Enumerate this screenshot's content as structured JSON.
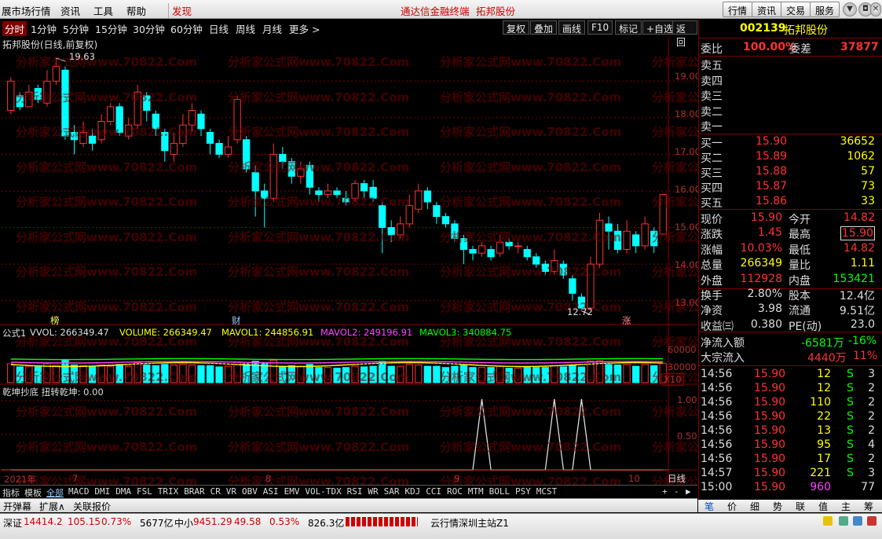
{
  "menu": {
    "left_items": [
      "展市场行情",
      "资讯",
      "工具",
      "帮助"
    ],
    "discover": "发现",
    "title": "通达信金融终端",
    "stock_name": "拓邦股份",
    "right_buttons": [
      "行情",
      "资讯",
      "交易",
      "服务"
    ]
  },
  "periods": [
    "分时",
    "1分钟",
    "5分钟",
    "15分钟",
    "30分钟",
    "60分钟",
    "日线",
    "周线",
    "月线",
    "更多 >"
  ],
  "tools": [
    "复权",
    "叠加",
    "画线",
    "F10",
    "标记",
    "+自选",
    "返回"
  ],
  "chart": {
    "title": "拓邦股份(日线,前复权)",
    "high_label": "19.63",
    "low_label": "12.72",
    "badge1": "榜",
    "badge2": "财",
    "badge3": "涨",
    "price_ticks": [
      "19.00",
      "18.00",
      "17.00",
      "16.00",
      "15.00",
      "14.00",
      "13.00"
    ],
    "watermark": "分析家公式网www.70822.Com",
    "vol_formula": "公式1",
    "vol_vvol": "VVOL: 266349.47",
    "vol_volume": "VOLUME: 266349.47",
    "vol_mavol1": "MAVOL1: 244856.91",
    "vol_mavol2": "MAVOL2: 249196.91",
    "vol_mavol3": "MAVOL3: 340884.75",
    "vol_ticks": [
      "60000",
      "30000",
      "X10"
    ],
    "ind_title": "乾坤抄底  扭转乾坤: 0.00",
    "ind_ticks": [
      "1.00",
      "0.50"
    ],
    "x_year": "2021年",
    "x_months": [
      "7",
      "8",
      "9",
      "10"
    ],
    "period_label": "日线"
  },
  "chart_data": {
    "type": "candlestick",
    "title": "拓邦股份(日线,前复权)",
    "ylim": [
      12.5,
      19.8
    ],
    "max_price": 19.63,
    "min_price": 12.72,
    "candles": [
      [
        18.2,
        19.0,
        19.1,
        18.1
      ],
      [
        18.6,
        18.3,
        18.7,
        18.2
      ],
      [
        18.3,
        18.7,
        18.9,
        18.3
      ],
      [
        18.8,
        18.5,
        18.9,
        18.4
      ],
      [
        18.4,
        19.0,
        19.3,
        18.3
      ],
      [
        19.0,
        19.4,
        19.63,
        18.9
      ],
      [
        19.3,
        17.5,
        19.4,
        17.4
      ],
      [
        17.6,
        17.4,
        17.8,
        17.0
      ],
      [
        17.3,
        17.6,
        17.9,
        17.2
      ],
      [
        17.5,
        17.3,
        17.7,
        17.1
      ],
      [
        17.4,
        17.9,
        18.1,
        17.3
      ],
      [
        17.9,
        18.3,
        18.4,
        17.8
      ],
      [
        18.3,
        17.6,
        18.4,
        17.5
      ],
      [
        17.5,
        17.8,
        18.0,
        17.4
      ],
      [
        17.8,
        18.7,
        18.9,
        17.7
      ],
      [
        18.6,
        18.2,
        18.7,
        17.9
      ],
      [
        18.1,
        17.7,
        18.2,
        17.5
      ],
      [
        17.6,
        17.1,
        17.7,
        16.8
      ],
      [
        17.0,
        17.3,
        17.6,
        16.8
      ],
      [
        17.3,
        17.8,
        18.1,
        17.2
      ],
      [
        17.8,
        18.2,
        18.4,
        17.6
      ],
      [
        18.1,
        17.7,
        18.2,
        17.5
      ],
      [
        17.6,
        17.3,
        17.7,
        17.0
      ],
      [
        17.3,
        17.0,
        17.4,
        16.9
      ],
      [
        17.0,
        17.2,
        17.5,
        16.9
      ],
      [
        17.4,
        18.5,
        18.6,
        17.3
      ],
      [
        17.4,
        16.6,
        17.5,
        16.5
      ],
      [
        16.5,
        16.0,
        16.7,
        15.3
      ],
      [
        16.0,
        15.8,
        16.2,
        15.0
      ],
      [
        15.8,
        17.0,
        17.3,
        15.7
      ],
      [
        17.0,
        16.8,
        17.2,
        16.6
      ],
      [
        16.8,
        16.4,
        16.9,
        16.2
      ],
      [
        16.4,
        16.6,
        16.8,
        16.2
      ],
      [
        16.7,
        16.1,
        16.8,
        15.9
      ],
      [
        16.0,
        15.9,
        16.1,
        15.7
      ],
      [
        15.9,
        16.0,
        16.2,
        15.8
      ],
      [
        16.0,
        15.9,
        16.1,
        15.8
      ],
      [
        15.8,
        15.7,
        16.0,
        15.6
      ],
      [
        15.8,
        16.2,
        16.3,
        15.7
      ],
      [
        16.2,
        16.0,
        16.3,
        15.8
      ],
      [
        16.1,
        15.8,
        16.3,
        15.7
      ],
      [
        15.6,
        15.0,
        15.7,
        14.3
      ],
      [
        15.0,
        14.8,
        15.2,
        14.6
      ],
      [
        14.8,
        15.1,
        15.3,
        14.7
      ],
      [
        15.1,
        15.6,
        15.9,
        15.0
      ],
      [
        15.5,
        16.0,
        16.2,
        15.4
      ],
      [
        16.0,
        15.7,
        16.1,
        15.5
      ],
      [
        15.6,
        15.3,
        15.7,
        15.1
      ],
      [
        15.3,
        15.1,
        15.4,
        15.0
      ],
      [
        15.1,
        14.7,
        15.2,
        14.6
      ],
      [
        14.7,
        14.4,
        14.8,
        14.0
      ],
      [
        14.4,
        14.3,
        14.5,
        14.1
      ],
      [
        14.3,
        14.5,
        14.6,
        14.2
      ],
      [
        14.4,
        14.2,
        14.5,
        14.1
      ],
      [
        14.3,
        14.6,
        14.8,
        14.2
      ],
      [
        14.6,
        14.5,
        14.7,
        14.4
      ],
      [
        14.5,
        14.5,
        14.6,
        14.3
      ],
      [
        14.4,
        14.2,
        14.5,
        14.1
      ],
      [
        14.2,
        14.0,
        14.3,
        13.9
      ],
      [
        14.0,
        13.8,
        14.1,
        13.7
      ],
      [
        13.8,
        14.1,
        14.4,
        13.7
      ],
      [
        14.0,
        13.7,
        14.1,
        13.6
      ],
      [
        13.6,
        13.2,
        13.7,
        13.0
      ],
      [
        13.1,
        12.8,
        13.2,
        12.72
      ],
      [
        12.8,
        14.0,
        14.2,
        12.75
      ],
      [
        14.0,
        15.2,
        15.4,
        13.9
      ],
      [
        15.1,
        14.9,
        15.3,
        14.4
      ],
      [
        14.9,
        14.4,
        15.1,
        14.3
      ],
      [
        14.4,
        14.9,
        15.2,
        14.3
      ],
      [
        14.8,
        14.5,
        14.9,
        14.3
      ],
      [
        14.5,
        15.1,
        15.3,
        14.4
      ],
      [
        14.9,
        14.5,
        15.0,
        14.3
      ],
      [
        14.82,
        15.9,
        15.9,
        14.82
      ]
    ],
    "volume_scale_ticks": [
      60000,
      30000
    ]
  },
  "quote": {
    "code": "002139",
    "name": "拓邦股份",
    "weibi_label": "委比",
    "weibi": "100.00%",
    "weicha_label": "委差",
    "weicha": "37877",
    "sells": [
      "卖五",
      "卖四",
      "卖三",
      "卖二",
      "卖一"
    ],
    "buys": [
      {
        "label": "买一",
        "price": "15.90",
        "vol": "36652"
      },
      {
        "label": "买二",
        "price": "15.89",
        "vol": "1062"
      },
      {
        "label": "买三",
        "price": "15.88",
        "vol": "57"
      },
      {
        "label": "买四",
        "price": "15.87",
        "vol": "73"
      },
      {
        "label": "买五",
        "price": "15.86",
        "vol": "33"
      }
    ],
    "stats": [
      {
        "l1": "现价",
        "v1": "15.90",
        "l2": "今开",
        "v2": "14.82"
      },
      {
        "l1": "涨跌",
        "v1": "1.45",
        "l2": "最高",
        "v2": "15.90"
      },
      {
        "l1": "涨幅",
        "v1": "10.03%",
        "l2": "最低",
        "v2": "14.82"
      },
      {
        "l1": "总量",
        "v1": "266349",
        "l2": "量比",
        "v2": "1.11"
      },
      {
        "l1": "外盘",
        "v1": "112928",
        "l2": "内盘",
        "v2": "153421"
      },
      {
        "l1": "换手",
        "v1": "2.80%",
        "l2": "股本",
        "v2": "12.4亿"
      },
      {
        "l1": "净资",
        "v1": "3.98",
        "l2": "流通",
        "v2": "9.51亿"
      },
      {
        "l1": "收益㈢",
        "v1": "0.380",
        "l2": "PE(动)",
        "v2": "23.0"
      }
    ],
    "flow1_label": "净流入额",
    "flow1_val": "-6581万",
    "flow1_pct": "-16%",
    "flow2_label": "大宗流入",
    "flow2_val": "4440万",
    "flow2_pct": "11%"
  },
  "ticks": [
    {
      "t": "14:56",
      "p": "15.90",
      "v": "12",
      "s": "S",
      "n": "3"
    },
    {
      "t": "14:56",
      "p": "15.90",
      "v": "12",
      "s": "S",
      "n": "2"
    },
    {
      "t": "14:56",
      "p": "15.90",
      "v": "110",
      "s": "S",
      "n": "2"
    },
    {
      "t": "14:56",
      "p": "15.90",
      "v": "22",
      "s": "S",
      "n": "2"
    },
    {
      "t": "14:56",
      "p": "15.90",
      "v": "13",
      "s": "S",
      "n": "2"
    },
    {
      "t": "14:56",
      "p": "15.90",
      "v": "95",
      "s": "S",
      "n": "4"
    },
    {
      "t": "14:56",
      "p": "15.90",
      "v": "17",
      "s": "S",
      "n": "2"
    },
    {
      "t": "14:57",
      "p": "15.90",
      "v": "221",
      "s": "S",
      "n": "3"
    },
    {
      "t": "15:00",
      "p": "15.90",
      "v": "960",
      "s": "",
      "n": "77"
    }
  ],
  "indicator_tabs": [
    "指标",
    "模板",
    "全部",
    "MACD",
    "DMI",
    "DMA",
    "FSL",
    "TRIX",
    "BRAR",
    "CR",
    "VR",
    "OBV",
    "ASI",
    "EMV",
    "VOL-TDX",
    "RSI",
    "WR",
    "SAR",
    "KDJ",
    "CCI",
    "ROC",
    "MTM",
    "BOLL",
    "PSY",
    "MCST"
  ],
  "bottom_btns": [
    "开弹幕",
    "扩展∧",
    "关联报价"
  ],
  "right_tabs": [
    "笔",
    "价",
    "细",
    "势",
    "联",
    "值",
    "主",
    "筹"
  ],
  "status": {
    "sz_label": "深证",
    "sz_val": "14414.2",
    "sz_chg": "105.15",
    "sz_pct": "0.73%",
    "sz_amt": "5677亿",
    "zx_label": "中小",
    "zx_val": "9451.29",
    "zx_chg": "49.58",
    "zx_pct": "0.53%",
    "zx_amt": "826.3亿",
    "server": "云行情深圳主站Z1"
  },
  "colors": {
    "up": "#ff3232",
    "down": "#00ffff",
    "bg": "#000000",
    "grid": "#800000"
  }
}
